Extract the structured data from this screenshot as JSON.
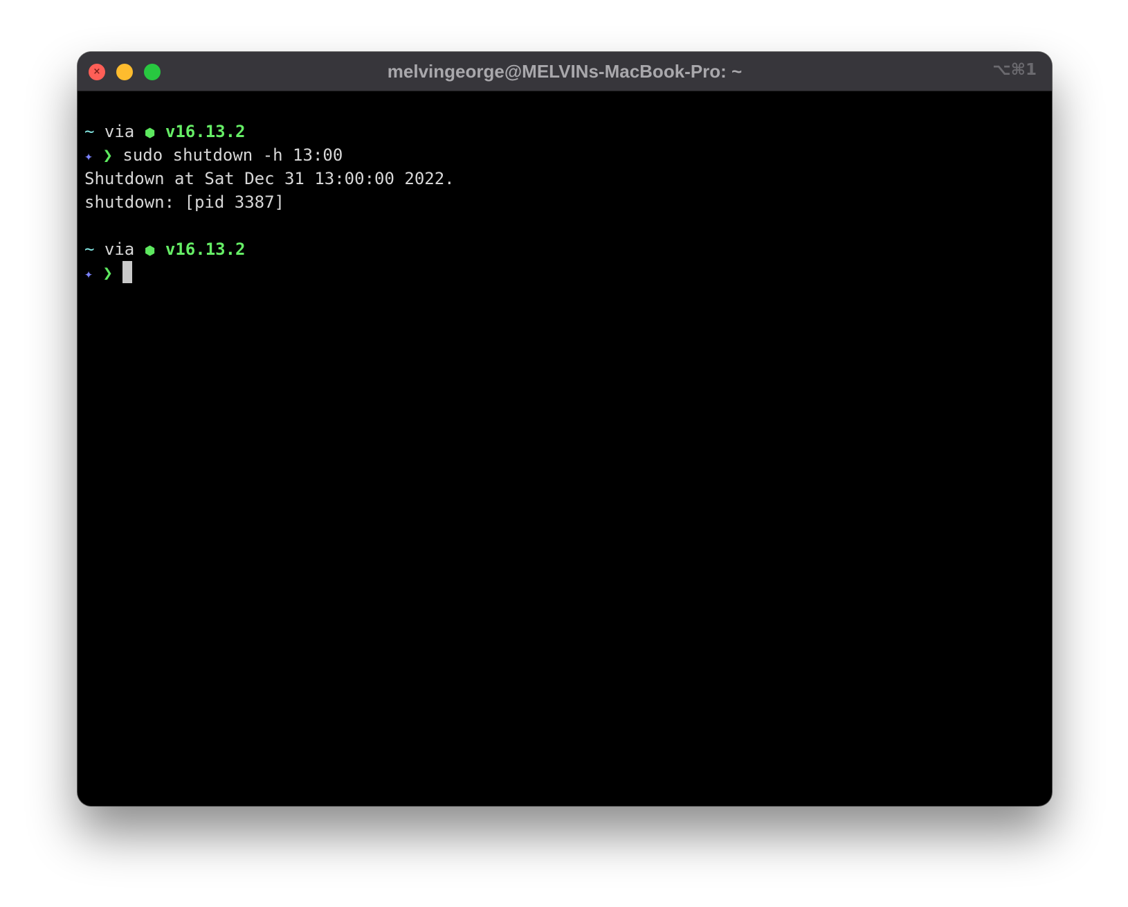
{
  "window": {
    "title": "melvingeorge@MELVINs-MacBook-Pro: ~",
    "shortcut": "⌥⌘1",
    "close_glyph": "×"
  },
  "prompt": {
    "tilde": "~",
    "via": "via",
    "node_icon": "⬢",
    "node_version": "v16.13.2",
    "star": "✦",
    "chevron": "❯"
  },
  "session": {
    "command": "sudo shutdown -h 13:00",
    "output_line_1": "Shutdown at Sat Dec 31 13:00:00 2022.",
    "output_line_2": "shutdown: [pid 3387]"
  },
  "icons": {
    "close": "close-icon",
    "minimize": "minimize-icon",
    "zoom": "zoom-icon",
    "node": "hexagon-icon",
    "star": "sparkle-icon",
    "chevron": "chevron-right-icon"
  },
  "colors": {
    "close": "#ff5f57",
    "minimize": "#febc2e",
    "zoom": "#28c840",
    "background": "#000000",
    "titlebar": "#37363b",
    "green": "#66ee66",
    "cyan": "#84e8e4",
    "purple": "#7b82ff"
  }
}
